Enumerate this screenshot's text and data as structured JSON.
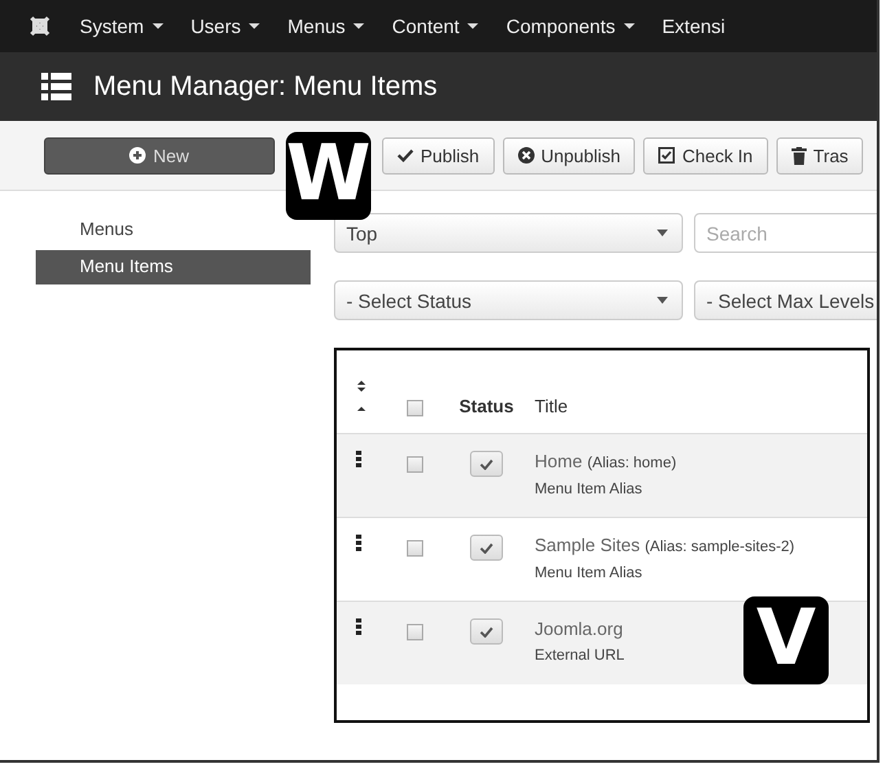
{
  "nav": {
    "items": [
      "System",
      "Users",
      "Menus",
      "Content",
      "Components",
      "Extensi"
    ]
  },
  "title_bar": {
    "title": "Menu Manager: Menu Items"
  },
  "toolbar": {
    "buttons": [
      {
        "label": "New",
        "kind": "new"
      },
      {
        "label": "Publish",
        "kind": "publish"
      },
      {
        "label": "Unpublish",
        "kind": "unpublish"
      },
      {
        "label": "Check In",
        "kind": "checkin"
      },
      {
        "label": "Tras",
        "kind": "trash"
      }
    ]
  },
  "sidebar": {
    "items": [
      {
        "label": "Menus",
        "selected": false
      },
      {
        "label": "Menu Items",
        "selected": true
      }
    ]
  },
  "filters": {
    "menu": "Top",
    "search": {
      "placeholder": "Search"
    },
    "status": "- Select Status",
    "max_levels": "- Select Max Levels"
  },
  "table": {
    "columns": [
      "Status",
      "Title"
    ],
    "select_all": {
      "checked": false
    },
    "rows": [
      {
        "checked": false,
        "published": true,
        "title": "Home",
        "alias": "(Alias: home)",
        "type": "Menu Item Alias"
      },
      {
        "checked": false,
        "published": true,
        "title": "Sample Sites",
        "alias": "(Alias: sample-sites-2)",
        "type": "Menu Item Alias"
      },
      {
        "checked": false,
        "published": true,
        "title": "Joomla.org",
        "type": "External URL"
      }
    ]
  },
  "callouts": [
    {
      "label": "W"
    },
    {
      "label": "V"
    }
  ]
}
